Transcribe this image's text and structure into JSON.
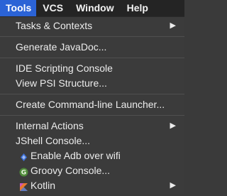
{
  "menubar": {
    "items": [
      "Tools",
      "VCS",
      "Window",
      "Help"
    ],
    "active_index": 0
  },
  "tools_menu": {
    "groups": [
      [
        {
          "label": "Tasks & Contexts",
          "submenu": true
        }
      ],
      [
        {
          "label": "Generate JavaDoc..."
        }
      ],
      [
        {
          "label": "IDE Scripting Console"
        },
        {
          "label": "View PSI Structure..."
        }
      ],
      [
        {
          "label": "Create Command-line Launcher..."
        }
      ],
      [
        {
          "label": "Internal Actions",
          "submenu": true
        },
        {
          "label": "JShell Console..."
        },
        {
          "label": "Enable Adb over wifi",
          "icon": "adb-icon"
        },
        {
          "label": "Groovy Console...",
          "icon": "groovy-icon"
        },
        {
          "label": "Kotlin",
          "icon": "kotlin-icon",
          "submenu": true
        }
      ]
    ]
  },
  "colors": {
    "menubar_bg": "#242424",
    "active_bg": "#2b63d6",
    "menu_bg": "#3b3b3b",
    "text": "#ececec"
  }
}
